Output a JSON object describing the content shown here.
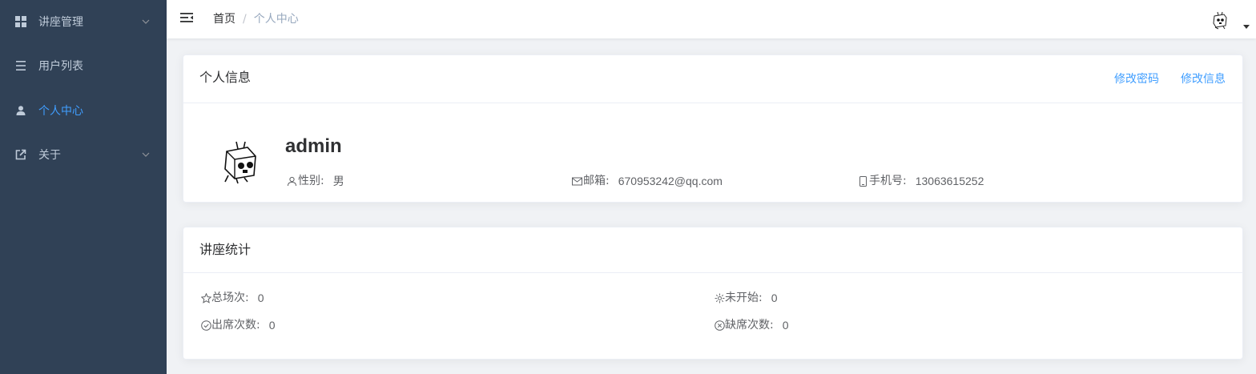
{
  "sidebar": {
    "items": [
      {
        "label": "讲座管理",
        "icon": "grid-icon",
        "has_arrow": true,
        "active": false
      },
      {
        "label": "用户列表",
        "icon": "list-icon",
        "has_arrow": false,
        "active": false
      },
      {
        "label": "个人中心",
        "icon": "user-icon",
        "has_arrow": false,
        "active": true
      },
      {
        "label": "关于",
        "icon": "external-link-icon",
        "has_arrow": true,
        "active": false
      }
    ],
    "bg_color": "#304156",
    "text_color": "#bfcbd9",
    "active_color": "#409eff"
  },
  "navbar": {
    "breadcrumb": {
      "home": "首页",
      "separator": "/",
      "current": "个人中心"
    }
  },
  "profile_card": {
    "title": "个人信息",
    "change_password": "修改密码",
    "edit_info": "修改信息",
    "username": "admin",
    "gender_label": "性别:",
    "gender_value": "男",
    "email_label": "邮箱:",
    "email_value": "670953242@qq.com",
    "phone_label": "手机号:",
    "phone_value": "13063615252"
  },
  "stats_card": {
    "title": "讲座统计",
    "total_label": "总场次:",
    "total_value": "0",
    "not_started_label": "未开始:",
    "not_started_value": "0",
    "attended_label": "出席次数:",
    "attended_value": "0",
    "absent_label": "缺席次数:",
    "absent_value": "0"
  }
}
